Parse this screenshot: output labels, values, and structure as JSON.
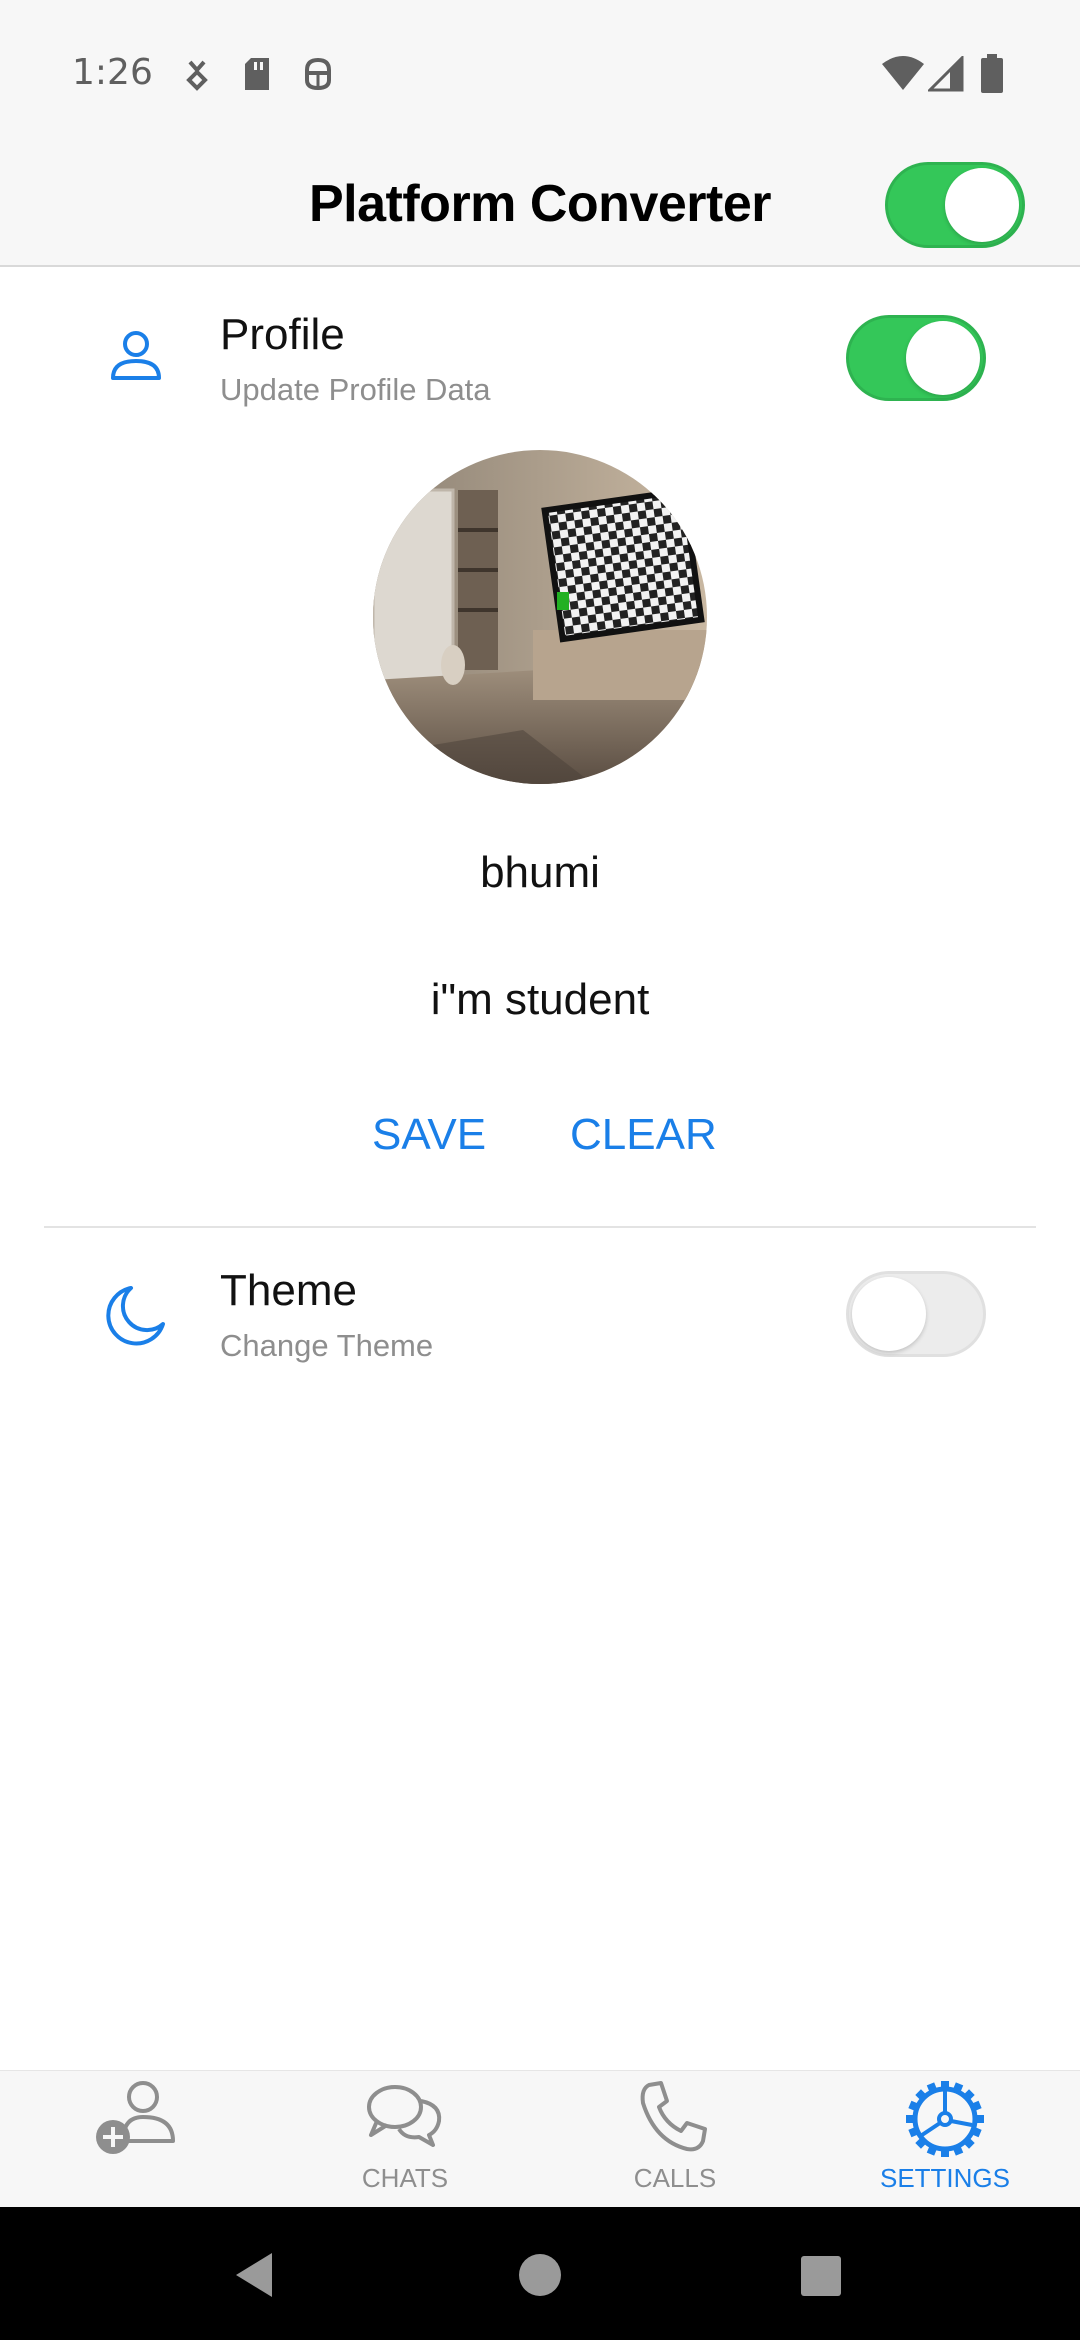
{
  "status_bar": {
    "time": "1:26",
    "left_icons": [
      "download-notification-icon",
      "sd-card-icon",
      "android-debug-icon"
    ],
    "right_icons": [
      "wifi-icon",
      "cell-signal-icon",
      "battery-icon"
    ]
  },
  "header": {
    "title": "Platform Converter",
    "platform_switch_on": true
  },
  "profile_section": {
    "icon": "person-icon",
    "title": "Profile",
    "subtitle": "Update Profile Data",
    "switch_on": true,
    "name": "bhumi",
    "bio": "i\"m student",
    "save_label": "SAVE",
    "clear_label": "CLEAR"
  },
  "theme_section": {
    "icon": "moon-icon",
    "title": "Theme",
    "subtitle": "Change Theme",
    "switch_on": false
  },
  "tabs": [
    {
      "label": "",
      "icon": "add-person-icon",
      "active": false
    },
    {
      "label": "CHATS",
      "icon": "chat-bubbles-icon",
      "active": false
    },
    {
      "label": "CALLS",
      "icon": "phone-icon",
      "active": false
    },
    {
      "label": "SETTINGS",
      "icon": "settings-gear-icon",
      "active": true
    }
  ],
  "colors": {
    "accent": "#1a7fe8",
    "switch_on": "#34c759",
    "inactive": "#8e8e8e"
  }
}
